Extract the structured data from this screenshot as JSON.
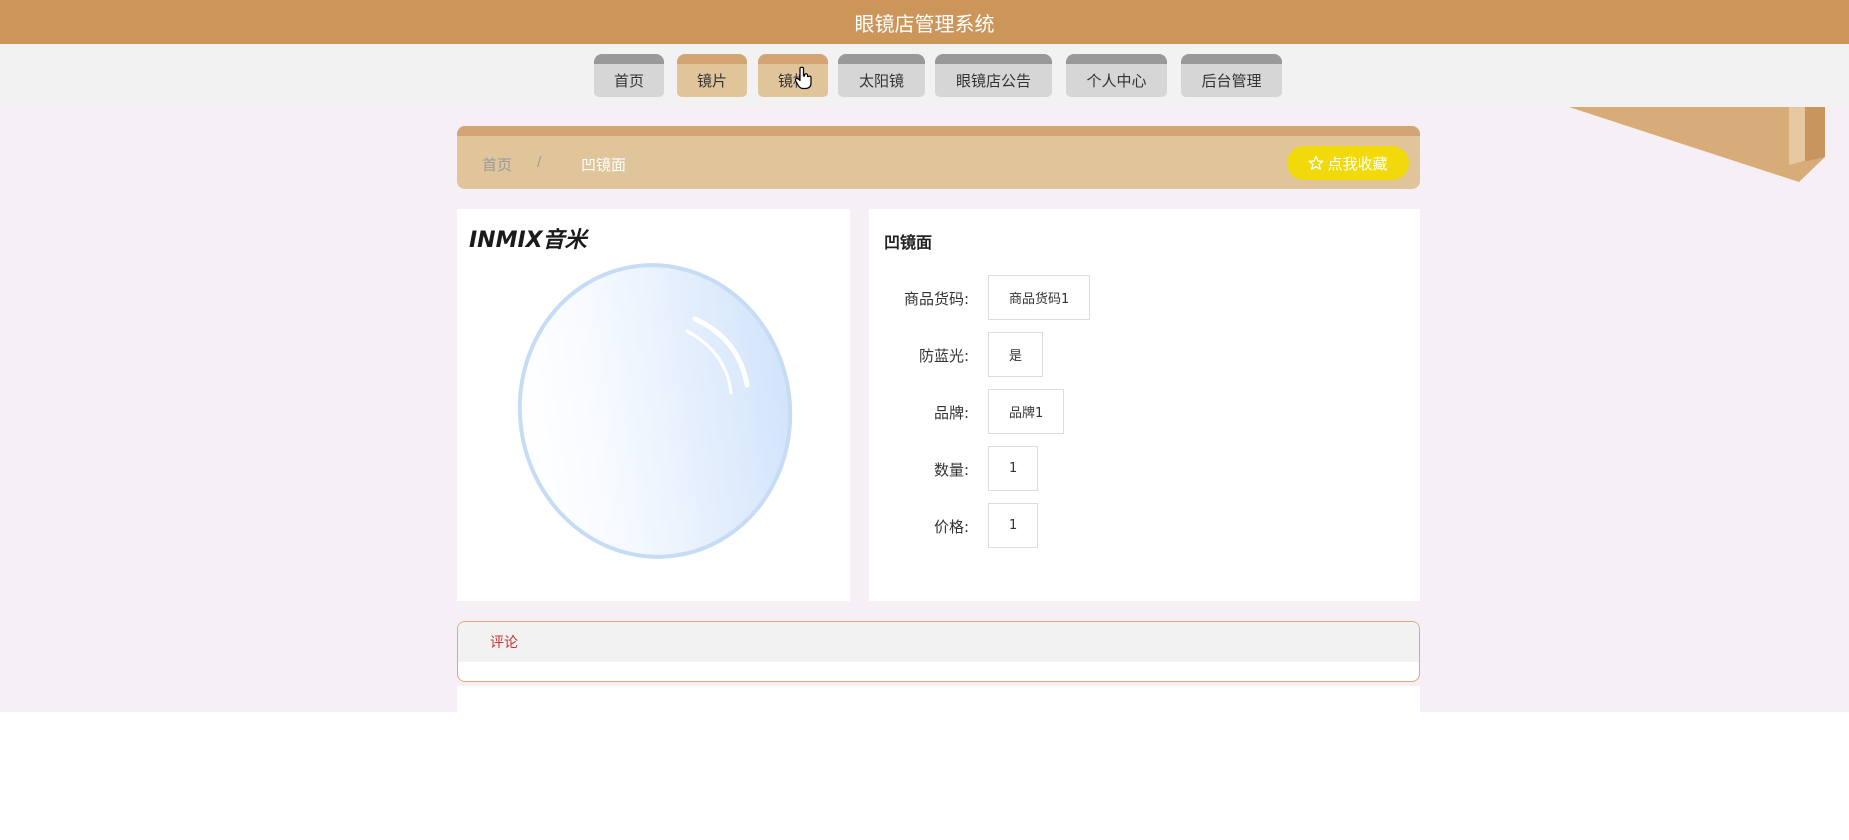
{
  "header": {
    "title": "眼镜店管理系统"
  },
  "nav": {
    "items": [
      {
        "label": "首页"
      },
      {
        "label": "镜片"
      },
      {
        "label": "镜框"
      },
      {
        "label": "太阳镜"
      },
      {
        "label": "眼镜店公告"
      },
      {
        "label": "个人中心"
      },
      {
        "label": "后台管理"
      }
    ]
  },
  "breadcrumb": {
    "home": "首页",
    "separator": "/",
    "current": "凹镜面"
  },
  "favorite": {
    "icon": "star-outline-icon",
    "label": "点我收藏"
  },
  "product": {
    "brand_logo": "INMIX音米",
    "title": "凹镜面",
    "fields": [
      {
        "label": "商品货码:",
        "value": "商品货码1"
      },
      {
        "label": "防蓝光:",
        "value": "是"
      },
      {
        "label": "品牌:",
        "value": "品牌1"
      },
      {
        "label": "数量:",
        "value": "1"
      },
      {
        "label": "价格:",
        "value": "1"
      }
    ]
  },
  "comments": {
    "tab_label": "评论"
  },
  "colors": {
    "header": "#cc955a",
    "nav_active": "#e0c49a",
    "favorite_button": "#f1d90a",
    "comment_tab_text": "#cc3333"
  }
}
